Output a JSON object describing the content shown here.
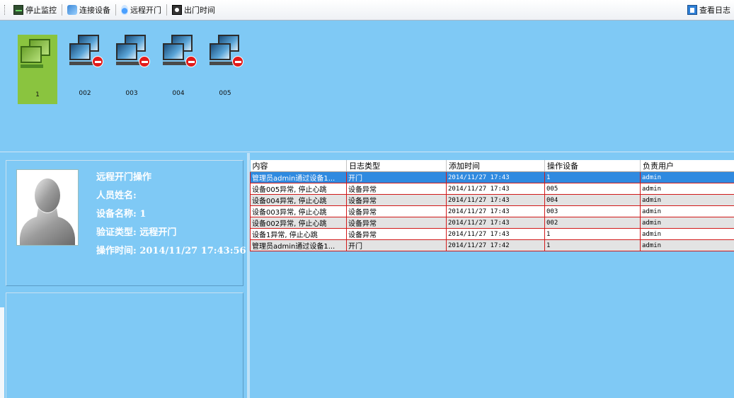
{
  "toolbar": {
    "stop_monitor": "停止监控",
    "connect_device": "连接设备",
    "remote_open": "远程开门",
    "exit_time": "出门时间",
    "view_log": "查看日志"
  },
  "devices": [
    {
      "label": "1",
      "state": "online",
      "icon": "computer-online-icon"
    },
    {
      "label": "002",
      "state": "offline",
      "icon": "computer-offline-icon"
    },
    {
      "label": "003",
      "state": "offline",
      "icon": "computer-offline-icon"
    },
    {
      "label": "004",
      "state": "offline",
      "icon": "computer-offline-icon"
    },
    {
      "label": "005",
      "state": "offline",
      "icon": "computer-offline-icon"
    }
  ],
  "info": {
    "title": "远程开门操作",
    "person": "人员姓名:",
    "device": "设备名称: 1",
    "verify": "验证类型: 远程开门",
    "time": "操作时间: 2014/11/27 17:43:56"
  },
  "log": {
    "headers": [
      "内容",
      "日志类型",
      "添加时间",
      "操作设备",
      "负责用户"
    ],
    "rows": [
      [
        "管理员admin通过设备1...",
        "开门",
        "2014/11/27 17:43",
        "1",
        "admin"
      ],
      [
        "设备005异常, 停止心跳",
        "设备异常",
        "2014/11/27 17:43",
        "005",
        "admin"
      ],
      [
        "设备004异常, 停止心跳",
        "设备异常",
        "2014/11/27 17:43",
        "004",
        "admin"
      ],
      [
        "设备003异常, 停止心跳",
        "设备异常",
        "2014/11/27 17:43",
        "003",
        "admin"
      ],
      [
        "设备002异常, 停止心跳",
        "设备异常",
        "2014/11/27 17:43",
        "002",
        "admin"
      ],
      [
        "设备1异常, 停止心跳",
        "设备异常",
        "2014/11/27 17:43",
        "1",
        "admin"
      ],
      [
        "管理员admin通过设备1...",
        "开门",
        "2014/11/27 17:42",
        "1",
        "admin"
      ]
    ],
    "selected_row": 0
  },
  "colors": {
    "background": "#7fc9f5",
    "selection": "#2f8ae0",
    "row_border": "#d11a1a",
    "device_active": "#8ac43f"
  }
}
